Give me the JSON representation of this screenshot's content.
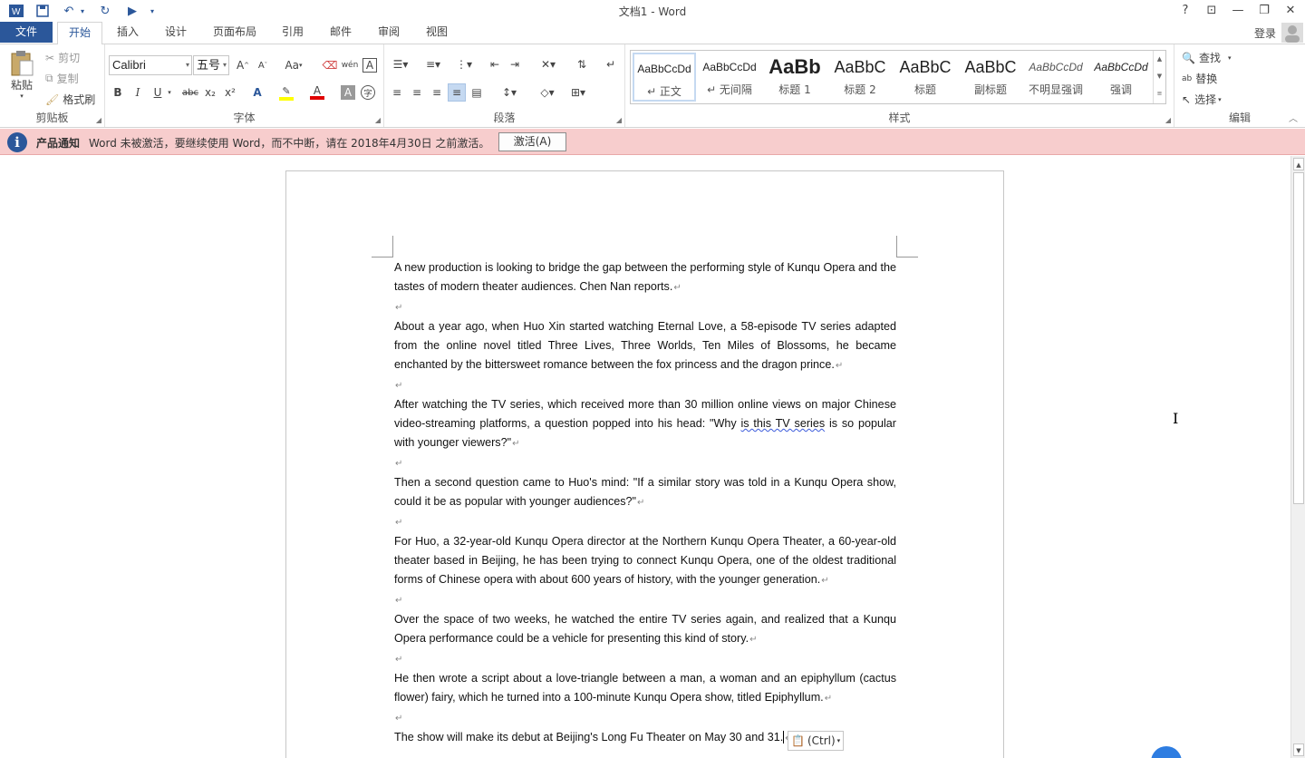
{
  "window": {
    "title": "文档1 - Word",
    "help": "?",
    "login": "登录"
  },
  "tabs": {
    "file": "文件",
    "items": [
      "开始",
      "插入",
      "设计",
      "页面布局",
      "引用",
      "邮件",
      "审阅",
      "视图"
    ]
  },
  "clipboard": {
    "paste": "粘贴",
    "cut": "剪切",
    "copy": "复制",
    "format_painter": "格式刷",
    "label": "剪贴板"
  },
  "font": {
    "name": "Calibri",
    "size": "五号",
    "label": "字体",
    "case": "Aa",
    "phonetic": "wén",
    "bold": "B",
    "italic": "I",
    "underline": "U",
    "strike": "abc",
    "sub": "x₂",
    "sup": "x²"
  },
  "paragraph": {
    "label": "段落"
  },
  "styles": {
    "label": "样式",
    "items": [
      {
        "preview": "AaBbCcDd",
        "name": "↵ 正文"
      },
      {
        "preview": "AaBbCcDd",
        "name": "↵ 无间隔"
      },
      {
        "preview": "AaBb",
        "name": "标题 1"
      },
      {
        "preview": "AaBbC",
        "name": "标题 2"
      },
      {
        "preview": "AaBbC",
        "name": "标题"
      },
      {
        "preview": "AaBbC",
        "name": "副标题"
      },
      {
        "preview": "AaBbCcDd",
        "name": "不明显强调"
      },
      {
        "preview": "AaBbCcDd",
        "name": "强调"
      }
    ]
  },
  "editing": {
    "find": "查找",
    "replace": "替换",
    "select": "选择",
    "label": "编辑"
  },
  "notice": {
    "title": "产品通知",
    "message": "Word 未被激活，要继续使用 Word，而不中断，请在 2018年4月30日 之前激活。",
    "button": "激活(A)"
  },
  "document": {
    "paragraphs": [
      "A new production is looking to bridge the gap between the performing style of Kunqu Opera and the tastes of modern theater audiences. Chen Nan reports.",
      "",
      "About a year ago, when Huo Xin started watching Eternal Love, a 58-episode TV series adapted from the online novel titled Three Lives, Three Worlds, Ten Miles of Blossoms, he became enchanted by the bittersweet romance between the fox princess and the dragon prince.",
      "",
      "After watching the TV series, which received more than 30 million online views on major Chinese video-streaming platforms, a question popped into his head: \"Why is this TV series is so popular with younger viewers?\"",
      "",
      "Then a second question came to Huo's mind: \"If a similar story was told in a Kunqu Opera show, could it be as popular with younger audiences?\"",
      "",
      "For Huo, a 32-year-old Kunqu Opera director at the Northern Kunqu Opera Theater, a 60-year-old theater based in Beijing, he has been trying to connect Kunqu Opera, one of the oldest traditional forms of Chinese opera with about 600 years of history, with the younger generation.",
      "",
      "Over the space of two weeks, he watched the entire TV series again, and realized that a Kunqu Opera performance could be a vehicle for presenting this kind of story.",
      "",
      "He then wrote a script about a love-triangle between a man, a woman and an epiphyllum (cactus flower) fairy, which he turned into a 100-minute Kunqu Opera show, titled Epiphyllum.",
      "",
      "The show will make its debut at Beijing's Long Fu Theater on May 30 and 31."
    ],
    "paste_options": "(Ctrl)"
  },
  "colors": {
    "accent": "#2b579a",
    "notice_bg": "#f7cdcd",
    "font_color_bar": "#e00000",
    "highlight_bar": "#ffff00"
  }
}
